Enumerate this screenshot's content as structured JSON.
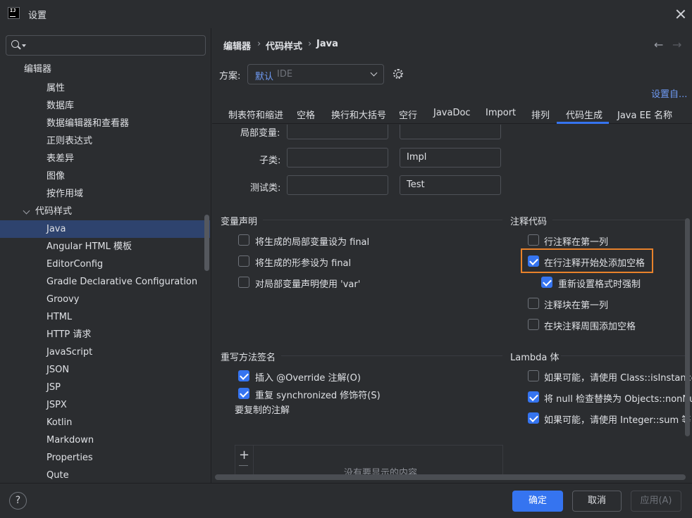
{
  "window": {
    "title": "设置",
    "logo": "IJ"
  },
  "search": {
    "placeholder": "",
    "icon": "search-icon"
  },
  "sidebar": {
    "items": [
      {
        "label": "编辑器"
      },
      {
        "label": "属性"
      },
      {
        "label": "数据库"
      },
      {
        "label": "数据编辑器和查看器"
      },
      {
        "label": "正则表达式"
      },
      {
        "label": "表差异"
      },
      {
        "label": "图像"
      },
      {
        "label": "按作用域"
      },
      {
        "label": "代码样式"
      },
      {
        "label": "Java"
      },
      {
        "label": "Angular HTML 模板"
      },
      {
        "label": "EditorConfig"
      },
      {
        "label": "Gradle Declarative Configuration"
      },
      {
        "label": "Groovy"
      },
      {
        "label": "HTML"
      },
      {
        "label": "HTTP 请求"
      },
      {
        "label": "JavaScript"
      },
      {
        "label": "JSON"
      },
      {
        "label": "JSP"
      },
      {
        "label": "JSPX"
      },
      {
        "label": "Kotlin"
      },
      {
        "label": "Markdown"
      },
      {
        "label": "Properties"
      },
      {
        "label": "Qute"
      }
    ]
  },
  "breadcrumb": [
    "编辑器",
    "代码样式",
    "Java"
  ],
  "breadcrumb_sep": "›",
  "nav": {
    "back": "←",
    "forward": "→"
  },
  "scheme": {
    "label": "方案:",
    "value_default": "默认",
    "value_ide": "IDE"
  },
  "set_link": "设置自...",
  "tabs": [
    "制表符和缩进",
    "空格",
    "换行和大括号",
    "空行",
    "JavaDoc",
    "Import",
    "排列",
    "代码生成",
    "Java EE 名称"
  ],
  "active_tab": "代码生成",
  "naming": {
    "rows": [
      {
        "label": "局部变量:",
        "prefix": "",
        "suffix": ""
      },
      {
        "label": "子类:",
        "prefix": "",
        "suffix": "Impl"
      },
      {
        "label": "测试类:",
        "prefix": "",
        "suffix": "Test"
      }
    ]
  },
  "variable_section": {
    "title": "变量声明",
    "options": [
      {
        "label": "将生成的局部变量设为 final",
        "checked": false
      },
      {
        "label": "将生成的形参设为 final",
        "checked": false
      },
      {
        "label": "对局部变量声明使用 'var'",
        "checked": false
      }
    ]
  },
  "comment_section": {
    "title": "注释代码",
    "options": [
      {
        "label": "行注释在第一列",
        "checked": false
      },
      {
        "label": "在行注释开始处添加空格",
        "checked": true
      },
      {
        "label": "重新设置格式时强制",
        "checked": true
      },
      {
        "label": "注释块在第一列",
        "checked": false
      },
      {
        "label": "在块注释周围添加空格",
        "checked": false
      }
    ]
  },
  "override_section": {
    "title": "重写方法签名",
    "options": [
      {
        "label": "插入 @Override 注解(O)",
        "checked": true
      },
      {
        "label": "重复 synchronized 修饰符(S)",
        "checked": true
      }
    ],
    "copy_label": "要复制的注解",
    "empty_text": "没有要显示的内容"
  },
  "lambda_section": {
    "title": "Lambda 体",
    "options": [
      {
        "label": "如果可能，请使用 Class::isInstance 和",
        "checked": false
      },
      {
        "label": "将 null 检查替换为 Objects::nonNull 或",
        "checked": true
      },
      {
        "label": "如果可能，请使用 Integer::sum 等",
        "checked": true
      }
    ]
  },
  "footer": {
    "help": "?",
    "ok": "确定",
    "cancel": "取消",
    "apply": "应用(A)"
  },
  "colors": {
    "accent": "#3574f0",
    "highlight": "#e8822b",
    "selected_row": "#2e436e",
    "link": "#6f9bf5"
  }
}
